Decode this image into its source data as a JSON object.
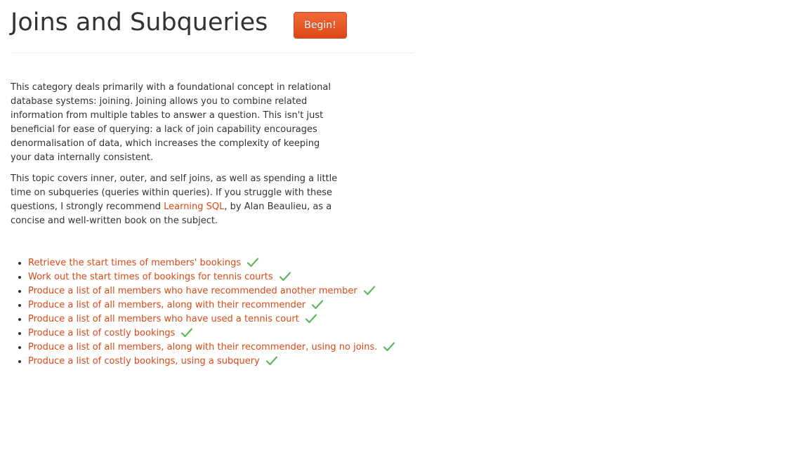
{
  "header": {
    "title": "Joins and Subqueries",
    "begin_label": "Begin!"
  },
  "intro": {
    "paragraph1": "This category deals primarily with a foundational concept in relational database systems: joining. Joining allows you to combine related information from multiple tables to answer a question. This isn't just beneficial for ease of querying: a lack of join capability encourages denormalisation of data, which increases the complexity of keeping your data internally consistent.",
    "paragraph2_before": "This topic covers inner, outer, and self joins, as well as spending a little time on subqueries (queries within queries). If you struggle with these questions, I strongly recommend ",
    "paragraph2_link": "Learning SQL",
    "paragraph2_after": ", by Alan Beaulieu, as a concise and well-written book on the subject."
  },
  "exercises": [
    {
      "label": "Retrieve the start times of members' bookings",
      "completed": true
    },
    {
      "label": "Work out the start times of bookings for tennis courts",
      "completed": true
    },
    {
      "label": "Produce a list of all members who have recommended another member",
      "completed": true
    },
    {
      "label": "Produce a list of all members, along with their recommender",
      "completed": true
    },
    {
      "label": "Produce a list of all members who have used a tennis court",
      "completed": true
    },
    {
      "label": "Produce a list of costly bookings",
      "completed": true
    },
    {
      "label": "Produce a list of all members, along with their recommender, using no joins.",
      "completed": true
    },
    {
      "label": "Produce a list of costly bookings, using a subquery",
      "completed": true
    }
  ],
  "colors": {
    "accent": "#dd4814",
    "check": "#5cb85c",
    "text": "#333333"
  }
}
